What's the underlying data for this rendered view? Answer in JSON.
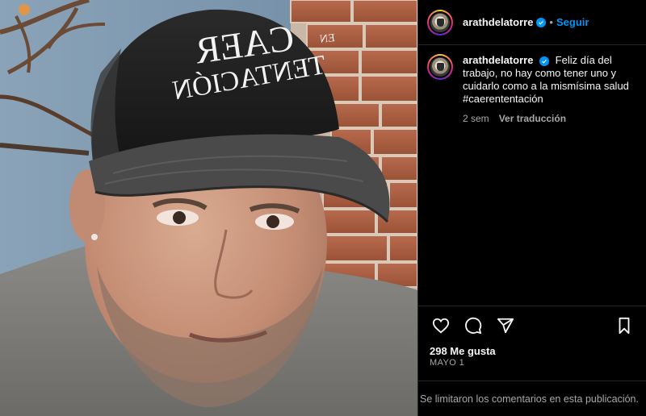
{
  "post": {
    "username": "arathdelatorre",
    "follow_label": "Seguir",
    "separator": "•",
    "caption": "Feliz día del trabajo, no hay como tener uno y cuidarlo como a la mismísima salud #caerententación",
    "time_ago": "2 sem",
    "translate_label": "Ver traducción",
    "likes": "298 Me gusta",
    "date": "MAYO 1",
    "comments_disabled_notice": "Se limitaron los comentarios en esta publicación."
  },
  "photo": {
    "cap_text_line1": "CAER",
    "cap_text_small": "EN",
    "cap_text_line2": "TENTACIÓN"
  },
  "icons": {
    "like": "heart-icon",
    "comment": "comment-icon",
    "share": "paper-plane-icon",
    "save": "bookmark-icon",
    "verified": "verified-badge-icon"
  },
  "colors": {
    "background": "#000000",
    "accent": "#0095f6",
    "muted_text": "#a8a8a8",
    "divider": "#262626"
  }
}
